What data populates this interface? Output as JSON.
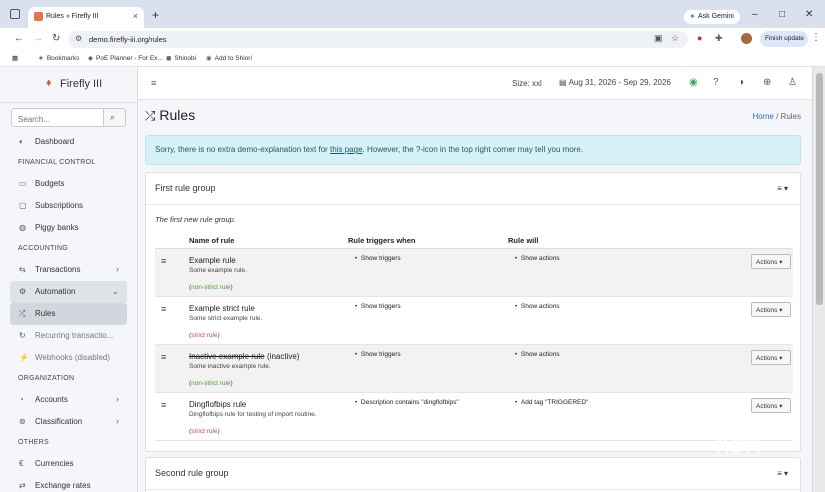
{
  "browser": {
    "tab_title": "Rules » Firefly III",
    "tab_close": "×",
    "new_tab": "+",
    "ask_gemini": "Ask Gemini",
    "ask_gemini_icon": "✦",
    "url": "demo.firefly-iii.org/rules",
    "finish_update": "Finish update",
    "window_minimize": "–",
    "window_maximize": "□",
    "window_close": "✕",
    "menu_dots": "⋮"
  },
  "bookmarks": [
    {
      "label": "Bookmarks",
      "icon": "★"
    },
    {
      "label": "PoE Planner - For Ex...",
      "icon": "◆"
    },
    {
      "label": "Shinobi",
      "icon": "◼"
    },
    {
      "label": "Add to Shiori",
      "icon": "◉"
    }
  ],
  "sidebar": {
    "brand": "Firefly III",
    "search_placeholder": "Search...",
    "search_icon": "⌕",
    "items": [
      {
        "label": "Dashboard",
        "icon": "◐"
      },
      {
        "header": "FINANCIAL CONTROL"
      },
      {
        "label": "Budgets",
        "icon": "▭"
      },
      {
        "label": "Subscriptions",
        "icon": "▢"
      },
      {
        "label": "Piggy banks",
        "icon": "◍"
      },
      {
        "header": "ACCOUNTING"
      },
      {
        "label": "Transactions",
        "icon": "⇆"
      },
      {
        "label": "Automation",
        "icon": "⚙"
      },
      {
        "label": "Rules",
        "icon": "⤮"
      },
      {
        "label": "Recurring transactio...",
        "icon": "↻"
      },
      {
        "label": "Webhooks (disabled)",
        "icon": "⚡"
      },
      {
        "header": "ORGANIZATION"
      },
      {
        "label": "Accounts",
        "icon": "◔"
      },
      {
        "label": "Classification",
        "icon": "⊚"
      },
      {
        "header": "OTHERS"
      },
      {
        "label": "Currencies",
        "icon": "€"
      },
      {
        "label": "Exchange rates",
        "icon": "⇄"
      }
    ]
  },
  "topbar": {
    "size_label": "Size: xxl",
    "date_range": "Aug 31, 2026 - Sep 29, 2026"
  },
  "page": {
    "title": "Rules",
    "breadcrumb_home": "Home",
    "breadcrumb_sep": "/",
    "breadcrumb_current": "Rules"
  },
  "alert": {
    "part1": "Sorry, there is no extra demo-explanation text for ",
    "link": "this page",
    "part2": ". However, the ",
    "icon": "?",
    "part3": "-icon in the top right corner may tell you more."
  },
  "rule_groups": [
    {
      "title": "First rule group",
      "description": "The first new rule group.",
      "columns": [
        "Name of rule",
        "Rule triggers when",
        "Rule will"
      ],
      "rules": [
        {
          "name": "Example rule",
          "suffix": "",
          "description": "Some example rule.",
          "strict": "non-strict rule",
          "trigger": "Show triggers",
          "action": "Show actions",
          "actions_button": "Actions ▾"
        },
        {
          "name": "Example strict rule",
          "suffix": "",
          "description": "Some strict example rule.",
          "strict": "strict rule",
          "trigger": "Show triggers",
          "action": "Show actions",
          "actions_button": "Actions ▾"
        },
        {
          "name": "Inactive example rule",
          "suffix": "(inactive)",
          "description": "Some inactive example rule.",
          "strict": "non-strict rule",
          "trigger": "Show triggers",
          "action": "Show actions",
          "actions_button": "Actions ▾"
        },
        {
          "name": "Dingflofbips rule",
          "suffix": "",
          "description": "Dingflofbips rule for testing of import routine.",
          "strict": "strict rule",
          "trigger": "Description contains \"dingflofbips\"",
          "action": "Add tag \"TRIGGERED\"",
          "actions_button": "Actions ▾"
        }
      ]
    },
    {
      "title": "Second rule group"
    }
  ],
  "watermark": "XDR"
}
